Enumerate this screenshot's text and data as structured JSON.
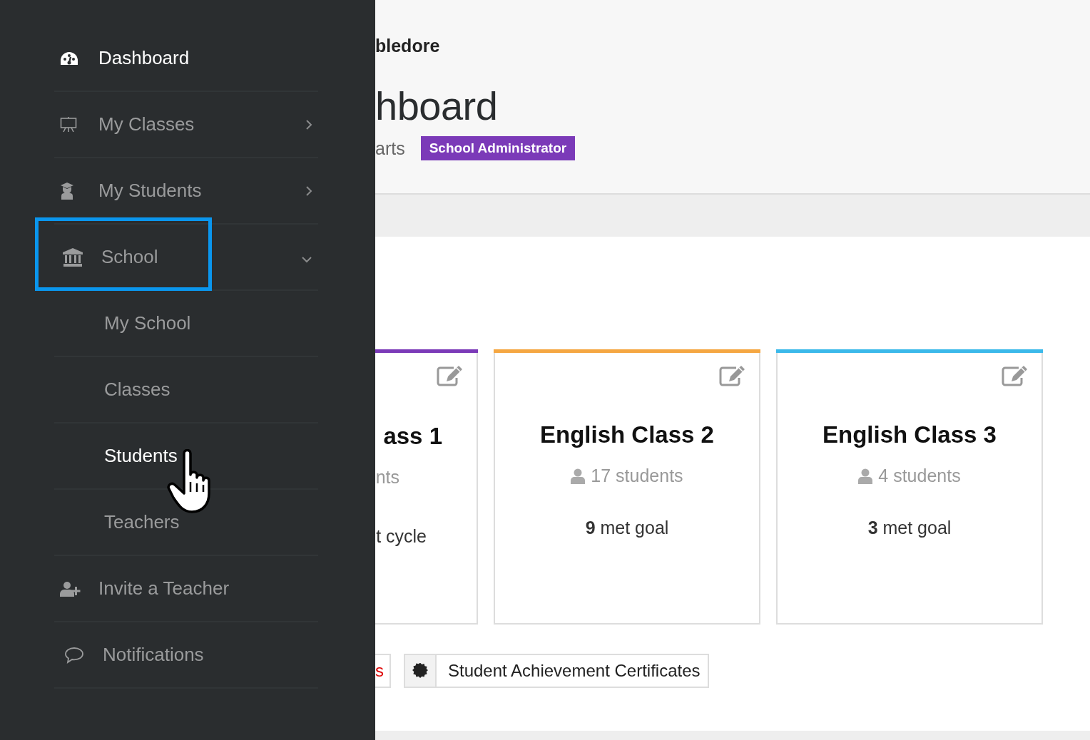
{
  "sidebar": {
    "items": [
      {
        "label": "Dashboard",
        "selected": true
      },
      {
        "label": "My Classes",
        "selected": false,
        "expanded": false
      },
      {
        "label": "My Students",
        "selected": false,
        "expanded": false
      },
      {
        "label": "School",
        "selected": false,
        "expanded": true,
        "children": [
          {
            "label": "My School",
            "selected": false
          },
          {
            "label": "Classes",
            "selected": false
          },
          {
            "label": "Students",
            "selected": true
          },
          {
            "label": "Teachers",
            "selected": false
          }
        ]
      },
      {
        "label": "Invite a Teacher",
        "selected": false
      },
      {
        "label": "Notifications",
        "selected": false
      }
    ]
  },
  "header": {
    "user_name": "bledore",
    "title": "hboard",
    "school": "arts",
    "role_badge": "School Administrator"
  },
  "cards": [
    {
      "kind": "partial",
      "title": "ass 1",
      "students": "nts",
      "goal": "t cycle",
      "color": "#7b3ab8"
    },
    {
      "kind": "full",
      "title": "English Class 2",
      "students": "17 students",
      "goal": "**9** met goal",
      "color": "#f5a742"
    },
    {
      "kind": "full",
      "title": "English Class 3",
      "students": "4 students",
      "goal": "**3** met goal",
      "color": "#3bb9ea"
    }
  ],
  "buttons": [
    {
      "kind": "partial",
      "label": "s"
    },
    {
      "kind": "icon",
      "label": "Student Achievement Certificates"
    }
  ]
}
